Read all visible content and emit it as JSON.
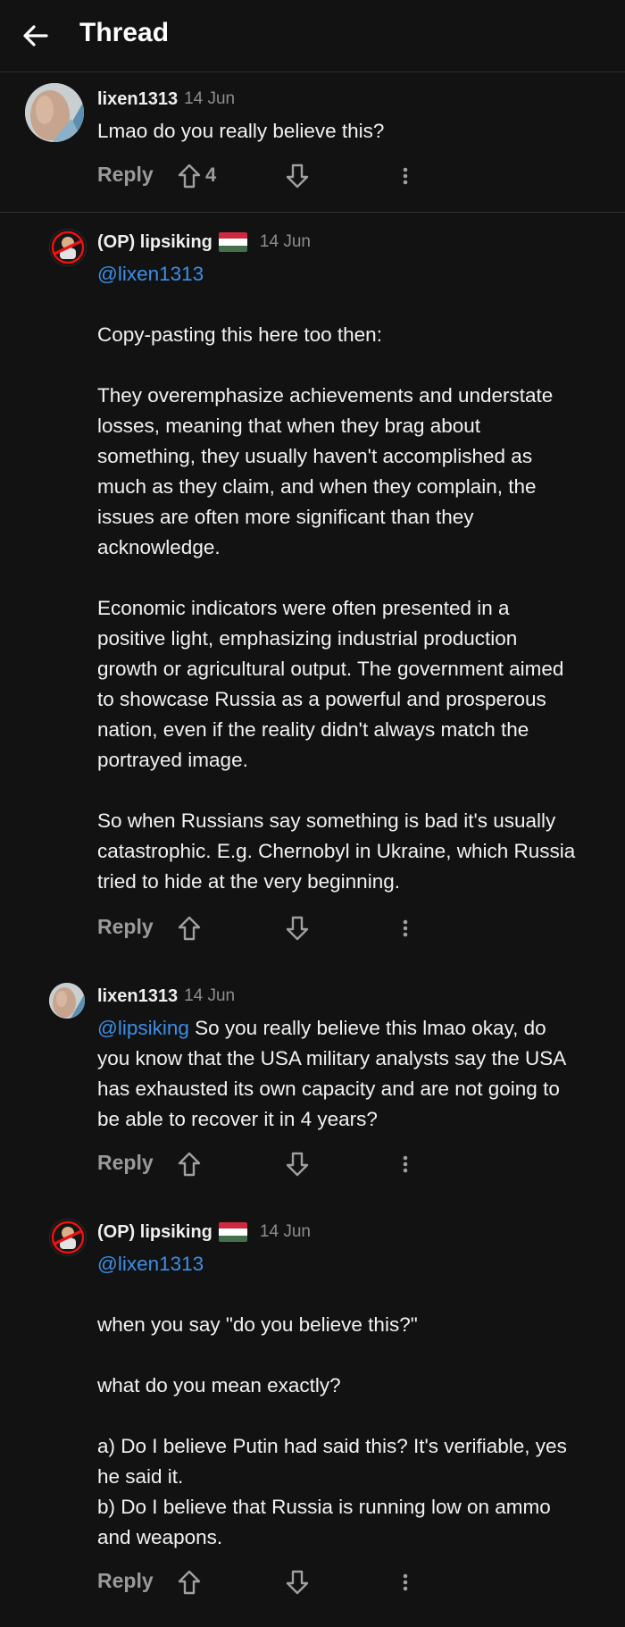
{
  "header": {
    "title": "Thread"
  },
  "comments": [
    {
      "username": "lixen1313",
      "timestamp": "14 Jun",
      "lines": [
        "Lmao do you really believe this?"
      ],
      "reply_label": "Reply",
      "vote_count": "4"
    },
    {
      "username": "(OP) lipsiking",
      "timestamp": "14 Jun",
      "flag_colors": [
        "#cd2a3e",
        "#ffffff",
        "#436f4d"
      ],
      "mention": "@lixen1313",
      "paragraphs": [
        [
          "Copy-pasting this here too then:"
        ],
        [
          "They overemphasize achievements and understate",
          "losses, meaning that when they brag about",
          "something, they usually haven't accomplished as",
          "much as they claim, and when they complain, the",
          "issues are often more significant than they",
          "acknowledge."
        ],
        [
          "Economic indicators were often presented in a",
          "positive light, emphasizing industrial production",
          "growth or agricultural output. The government aimed",
          "to showcase Russia as a powerful and prosperous",
          "nation, even if the reality didn't always match the",
          "portrayed image."
        ],
        [
          "So when Russians say something is bad it's usually",
          "catastrophic. E.g. Chernobyl in Ukraine, which Russia",
          "tried to hide at the very beginning."
        ]
      ],
      "reply_label": "Reply"
    },
    {
      "username": "lixen1313",
      "timestamp": "14 Jun",
      "mention": "@lipsiking",
      "first_line_rest": " So you really believe this lmao okay, do",
      "lines": [
        "you know that the USA military analysts say the USA",
        "has exhausted its own capacity and are not going to",
        "be able to recover it in 4 years?"
      ],
      "reply_label": "Reply"
    },
    {
      "username": "(OP) lipsiking",
      "timestamp": "14 Jun",
      "flag_colors": [
        "#cd2a3e",
        "#ffffff",
        "#436f4d"
      ],
      "mention": "@lixen1313",
      "paragraphs": [
        [
          "when you say \"do you believe this?\""
        ],
        [
          "what do you mean exactly?"
        ],
        [
          "a) Do I believe Putin had said this? It's verifiable, yes",
          "he said it.",
          "b) Do I believe that Russia is running low on ammo",
          "and weapons."
        ]
      ],
      "reply_label": "Reply"
    }
  ],
  "colors": {
    "background": "#121212",
    "mention": "#3b8fe8",
    "muted": "#9a9a9a"
  }
}
